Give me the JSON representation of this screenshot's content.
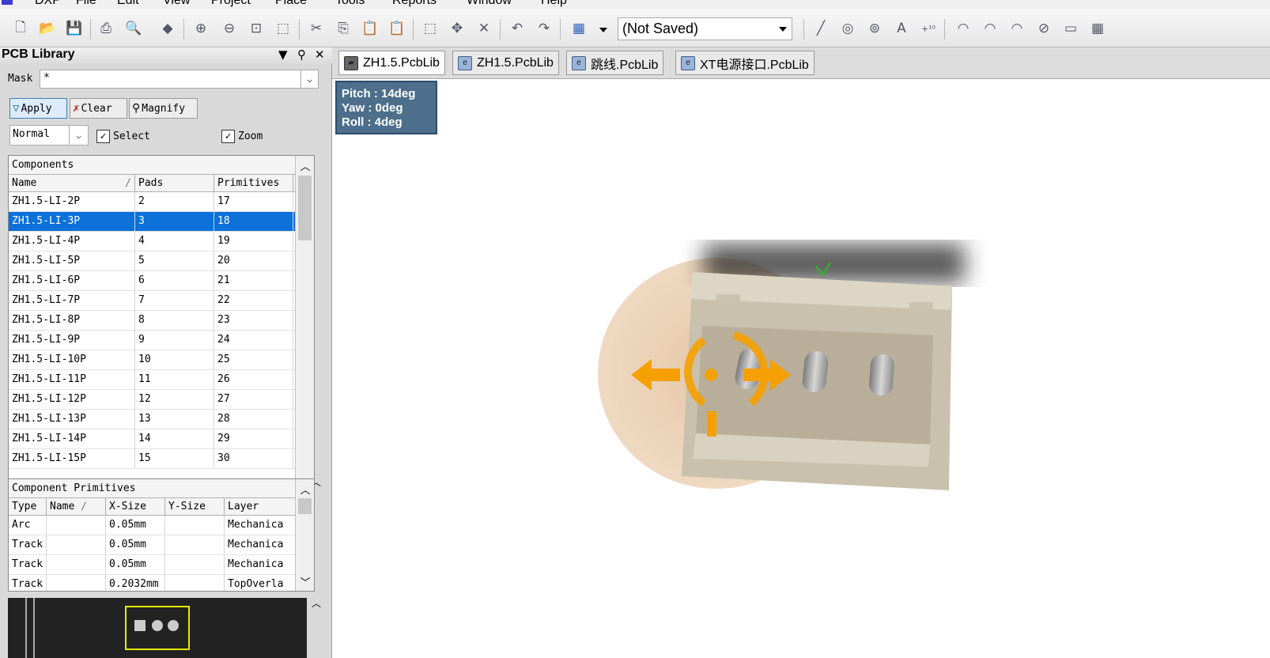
{
  "menu": [
    "DXP",
    "File",
    "Edit",
    "View",
    "Project",
    "Place",
    "Tools",
    "Reports",
    "Window",
    "Help"
  ],
  "toolbar": {
    "view_combo": "(Not Saved)"
  },
  "panel": {
    "title": "PCB Library",
    "mask_label": "Mask",
    "mask_value": "*",
    "apply": "Apply",
    "clear": "Clear",
    "magnify": "Magnify",
    "mode": "Normal",
    "select": "Select",
    "zoom": "Zoom",
    "components_caption": "Components",
    "components_headers": [
      "Name",
      "Pads",
      "Primitives"
    ],
    "components": [
      {
        "name": "ZH1.5-LI-2P",
        "pads": "2",
        "prims": "17"
      },
      {
        "name": "ZH1.5-LI-3P",
        "pads": "3",
        "prims": "18"
      },
      {
        "name": "ZH1.5-LI-4P",
        "pads": "4",
        "prims": "19"
      },
      {
        "name": "ZH1.5-LI-5P",
        "pads": "5",
        "prims": "20"
      },
      {
        "name": "ZH1.5-LI-6P",
        "pads": "6",
        "prims": "21"
      },
      {
        "name": "ZH1.5-LI-7P",
        "pads": "7",
        "prims": "22"
      },
      {
        "name": "ZH1.5-LI-8P",
        "pads": "8",
        "prims": "23"
      },
      {
        "name": "ZH1.5-LI-9P",
        "pads": "9",
        "prims": "24"
      },
      {
        "name": "ZH1.5-LI-10P",
        "pads": "10",
        "prims": "25"
      },
      {
        "name": "ZH1.5-LI-11P",
        "pads": "11",
        "prims": "26"
      },
      {
        "name": "ZH1.5-LI-12P",
        "pads": "12",
        "prims": "27"
      },
      {
        "name": "ZH1.5-LI-13P",
        "pads": "13",
        "prims": "28"
      },
      {
        "name": "ZH1.5-LI-14P",
        "pads": "14",
        "prims": "29"
      },
      {
        "name": "ZH1.5-LI-15P",
        "pads": "15",
        "prims": "30"
      }
    ],
    "selected_component": "ZH1.5-LI-3P",
    "primitives_caption": "Component Primitives",
    "primitives_headers": [
      "Type",
      "Name",
      "X-Size",
      "Y-Size",
      "Layer"
    ],
    "primitives": [
      {
        "type": "Arc",
        "name": "",
        "xs": "0.05mm",
        "ys": "",
        "layer": "Mechanica"
      },
      {
        "type": "Track",
        "name": "",
        "xs": "0.05mm",
        "ys": "",
        "layer": "Mechanica"
      },
      {
        "type": "Track",
        "name": "",
        "xs": "0.05mm",
        "ys": "",
        "layer": "Mechanica"
      },
      {
        "type": "Track",
        "name": "",
        "xs": "0.2032mm",
        "ys": "",
        "layer": "TopOverla"
      }
    ]
  },
  "tabs": [
    "ZH1.5.PcbLib",
    "ZH1.5.PcbLib",
    "跳线.PcbLib",
    "XT电源接口.PcbLib"
  ],
  "hud": {
    "pitch": "Pitch : 14deg",
    "yaw": "Yaw : 0deg",
    "roll": "Roll : 4deg"
  }
}
